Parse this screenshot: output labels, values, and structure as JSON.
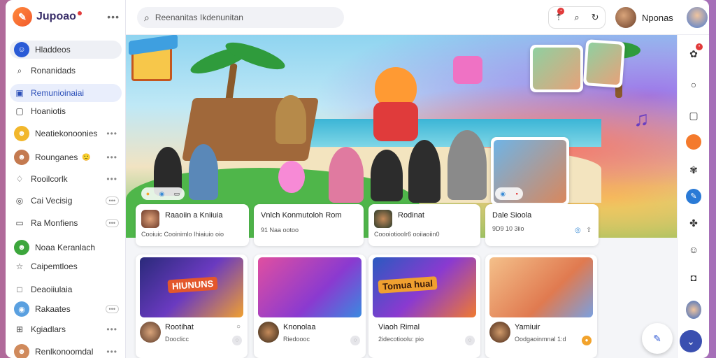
{
  "app": {
    "name": "Jupoao",
    "more": "•••"
  },
  "search": {
    "placeholder": "Reenanitas Ikdenunitan"
  },
  "user": {
    "name": "Nponas"
  },
  "sidebar": {
    "items": [
      {
        "label": "Hladdeos",
        "icon": "person-icon"
      },
      {
        "label": "Ronanidads",
        "icon": "search-icon"
      },
      {
        "label": "Remunioinaiai",
        "icon": "bookmark-icon"
      },
      {
        "label": "Hoaniotis",
        "icon": "calendar-icon"
      },
      {
        "label": "Neatiekonoonies",
        "icon": "avatar",
        "more": "•••"
      },
      {
        "label": "Rounganes",
        "icon": "avatar",
        "more": "•••"
      },
      {
        "label": "Rooilcorlk",
        "icon": "bell-icon",
        "more": "•••"
      },
      {
        "label": "Cai Vecisig",
        "icon": "globe-icon",
        "pill": "•••"
      },
      {
        "label": "Ra Monfiens",
        "icon": "flag-icon",
        "pill": "•••"
      },
      {
        "label": "Noaa Keranlach",
        "icon": "avatar"
      },
      {
        "label": "Caipemtloes",
        "icon": "star-icon"
      },
      {
        "label": "Deaoiiulaia",
        "icon": "square-icon"
      },
      {
        "label": "Rakaates",
        "icon": "globe-icon",
        "pill": "•••"
      },
      {
        "label": "Kgiadlars",
        "icon": "grid-icon",
        "more": "•••"
      },
      {
        "label": "Renlkonoomdal",
        "icon": "avatar",
        "more": "•••"
      }
    ]
  },
  "hero_cards": [
    {
      "title": "Raaoiin a Kniiuia",
      "meta": "Cooiuic Cooinimlo Ihiaiuio oio"
    },
    {
      "title": "Vnlch Konmutoloh Rom",
      "meta": "91 Naa ootoo"
    },
    {
      "title": "Rodinat",
      "meta": "Coooiotioolr6 ooiiaoiin0"
    },
    {
      "title": "Dale Sioola",
      "meta": "9D9 10 3iio"
    }
  ],
  "tiles": [
    {
      "banner": "HIUNUNS",
      "name": "Rootihat",
      "sub": "Dooclicc"
    },
    {
      "banner": "",
      "name": "Knonolaa",
      "sub": "Riedoooc"
    },
    {
      "banner": "Tomua hual",
      "name": "Viaoh Rimal",
      "sub": "2idecotioolu: pio"
    },
    {
      "banner": "",
      "name": "Yamiuir",
      "sub": "Oodgaoinmnal 1:d"
    }
  ]
}
